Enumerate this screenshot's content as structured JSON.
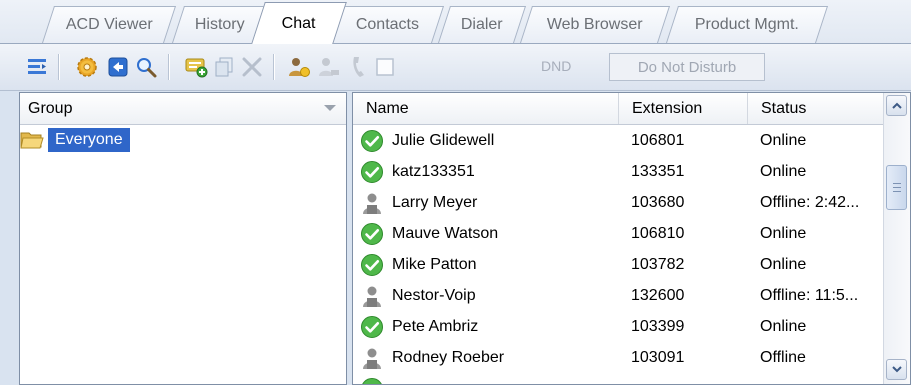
{
  "tabs": [
    {
      "label": "ACD Viewer",
      "active": false
    },
    {
      "label": "History",
      "active": false
    },
    {
      "label": "Chat",
      "active": true
    },
    {
      "label": "Contacts",
      "active": false
    },
    {
      "label": "Dialer",
      "active": false
    },
    {
      "label": "Web Browser",
      "active": false
    },
    {
      "label": "Product Mgmt.",
      "active": false
    }
  ],
  "toolbar": {
    "icons": [
      "columns-icon",
      "gear-icon",
      "back-icon",
      "search-icon",
      "add-chat-icon",
      "copy-icon",
      "delete-icon",
      "user-status-icon",
      "user-disabled-icon",
      "phone-icon",
      "checkbox-icon"
    ],
    "dnd_label": "DND",
    "dnd_value": "Do Not Disturb"
  },
  "left_pane": {
    "header": "Group",
    "groups": [
      {
        "label": "Everyone",
        "selected": true
      }
    ]
  },
  "right_pane": {
    "columns": [
      "Name",
      "Extension",
      "Status"
    ],
    "rows": [
      {
        "name": "Julie Glidewell",
        "extension": "106801",
        "status": "Online",
        "icon": "online-check-icon"
      },
      {
        "name": "katz133351",
        "extension": "133351",
        "status": "Online",
        "icon": "online-check-icon"
      },
      {
        "name": "Larry Meyer",
        "extension": "103680",
        "status": "Offline: 2:42...",
        "icon": "offline-user-icon"
      },
      {
        "name": "Mauve Watson",
        "extension": "106810",
        "status": "Online",
        "icon": "online-check-icon"
      },
      {
        "name": "Mike Patton",
        "extension": "103782",
        "status": "Online",
        "icon": "online-check-icon"
      },
      {
        "name": "Nestor-Voip",
        "extension": "132600",
        "status": "Offline: 11:5...",
        "icon": "offline-user-icon"
      },
      {
        "name": "Pete Ambriz",
        "extension": "103399",
        "status": "Online",
        "icon": "online-check-icon"
      },
      {
        "name": "Rodney Roeber",
        "extension": "103091",
        "status": "Offline",
        "icon": "offline-user-icon"
      }
    ]
  },
  "colors": {
    "selection": "#2f66c9",
    "online": "#4fb84a",
    "offline": "#8e8e8e"
  }
}
